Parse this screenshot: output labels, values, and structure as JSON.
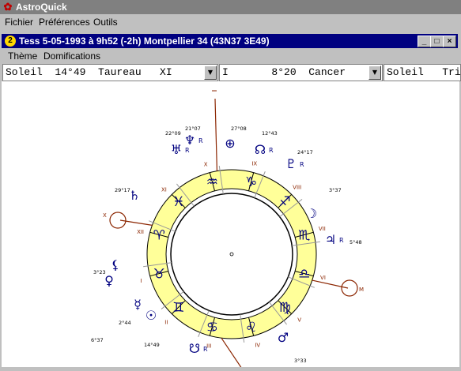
{
  "app": {
    "title": "AstroQuick",
    "menu": [
      "Fichier",
      "Préférences",
      "Outils"
    ]
  },
  "chart_window": {
    "title": "Tess  5-05-1993 à 9h52  (-2h)  Montpellier 34 (43N37  3E49)",
    "menu": [
      "Thème",
      "Domifications"
    ],
    "selectors": [
      {
        "value": "Soleil  14°49  Taureau   XI"
      },
      {
        "value": "I       8°20  Cancer"
      },
      {
        "value": "Soleil   Trig"
      }
    ]
  },
  "wheel": {
    "signs": [
      "♈",
      "♉",
      "♊",
      "♋",
      "♌",
      "♍",
      "♎",
      "♏",
      "♐",
      "♑",
      "♒",
      "♓"
    ],
    "houses": [
      "I",
      "II",
      "III",
      "IV",
      "V",
      "VI",
      "VII",
      "VIII",
      "IX",
      "X",
      "XI",
      "XII"
    ],
    "planet_labels": [
      {
        "glyph": "☉",
        "deg": "14°49"
      },
      {
        "glyph": "☽",
        "deg": "3°37"
      },
      {
        "glyph": "☿",
        "deg": "2°44"
      },
      {
        "glyph": "♀",
        "deg": "6°37"
      },
      {
        "glyph": "♂",
        "deg": "3°33"
      },
      {
        "glyph": "♃",
        "deg": "5°48",
        "retro": "R"
      },
      {
        "glyph": "♄",
        "deg": "29°17"
      },
      {
        "glyph": "♅",
        "deg": "22°09",
        "retro": "R"
      },
      {
        "glyph": "♆",
        "deg": "21°07",
        "retro": "R"
      },
      {
        "glyph": "♇",
        "deg": "24°17",
        "retro": "R"
      },
      {
        "glyph": "☊",
        "deg": "12°43",
        "retro": "R"
      },
      {
        "glyph": "☋",
        "deg": "12°43",
        "retro": "R"
      },
      {
        "glyph": "⊕",
        "deg": "27°08"
      },
      {
        "glyph": "⚸",
        "deg": "3°23"
      }
    ],
    "axis_labels": [
      "X",
      "M"
    ]
  }
}
